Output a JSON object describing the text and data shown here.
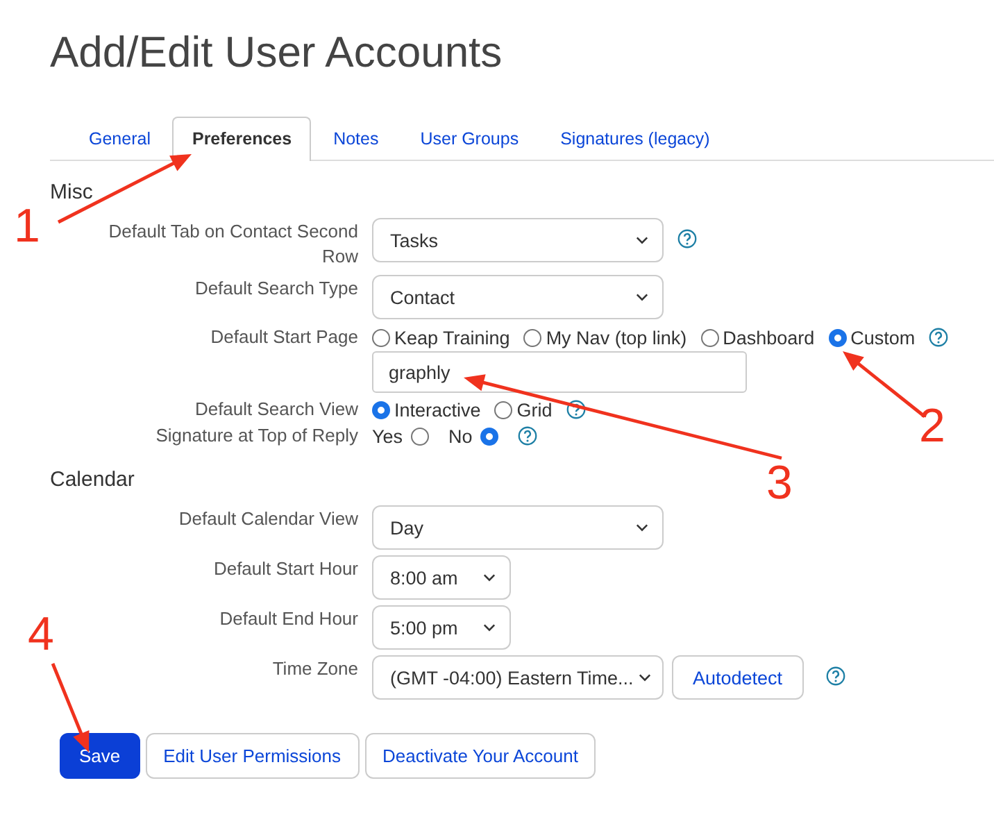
{
  "title": "Add/Edit User Accounts",
  "tabs": [
    {
      "label": "General",
      "selected": false
    },
    {
      "label": "Preferences",
      "selected": true
    },
    {
      "label": "Notes",
      "selected": false
    },
    {
      "label": "User Groups",
      "selected": false
    },
    {
      "label": "Signatures (legacy)",
      "selected": false
    }
  ],
  "sections": [
    {
      "heading": "Misc",
      "rows": [
        {
          "kind": "select",
          "label": "Default Tab on Contact Second Row",
          "value": "Tasks",
          "help": true
        },
        {
          "kind": "select",
          "label": "Default Search Type",
          "value": "Contact",
          "help": false
        },
        {
          "kind": "radios",
          "label": "Default Start Page",
          "help": true,
          "options": [
            {
              "label": "Keap Training",
              "selected": false
            },
            {
              "label": "My Nav (top link)",
              "selected": false
            },
            {
              "label": "Dashboard",
              "selected": false
            },
            {
              "label": "Custom",
              "selected": true
            }
          ]
        },
        {
          "kind": "text",
          "value": "graphly"
        },
        {
          "kind": "radios",
          "label": "Default Search View",
          "help": true,
          "options": [
            {
              "label": "Interactive",
              "selected": true
            },
            {
              "label": "Grid",
              "selected": false
            }
          ]
        },
        {
          "kind": "radios_after",
          "label": "Signature at Top of Reply",
          "help": true,
          "options": [
            {
              "label": "Yes",
              "selected": false
            },
            {
              "label": "No",
              "selected": true
            }
          ]
        }
      ]
    },
    {
      "heading": "Calendar",
      "rows": [
        {
          "kind": "select",
          "label": "Default Calendar View",
          "value": "Day",
          "help": false
        },
        {
          "kind": "short_select",
          "label": "Default Start Hour",
          "value": "8:00 am",
          "help": false
        },
        {
          "kind": "short_select",
          "label": "Default End Hour",
          "value": "5:00 pm",
          "help": false
        },
        {
          "kind": "select",
          "label": "Time Zone",
          "value": "(GMT -04:00) Eastern Time...",
          "button": "Autodetect",
          "help": true
        }
      ]
    }
  ],
  "buttons": [
    {
      "label": "Save",
      "kind": "primary"
    },
    {
      "label": "Edit User Permissions",
      "kind": "secondary"
    },
    {
      "label": "Deactivate Your Account",
      "kind": "secondary"
    }
  ],
  "annotations": [
    {
      "text": "1"
    },
    {
      "text": "2"
    },
    {
      "text": "3"
    },
    {
      "text": "4"
    }
  ]
}
